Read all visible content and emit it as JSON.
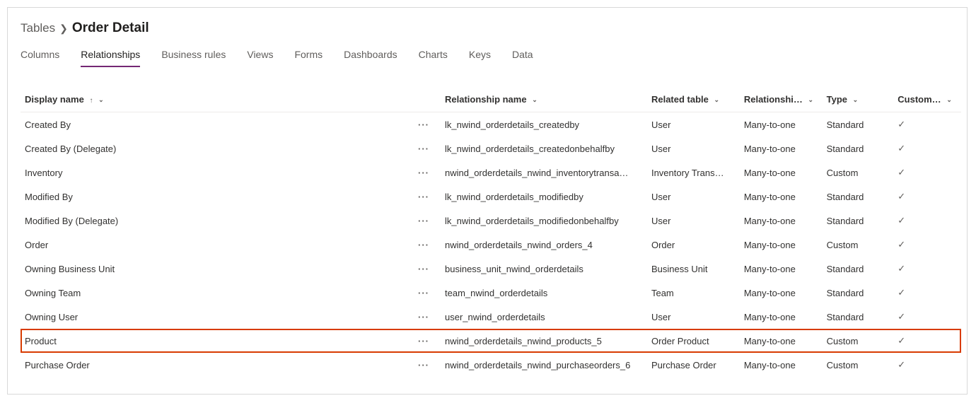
{
  "breadcrumb": {
    "root": "Tables",
    "current": "Order Detail"
  },
  "tabs": [
    {
      "label": "Columns",
      "active": false
    },
    {
      "label": "Relationships",
      "active": true
    },
    {
      "label": "Business rules",
      "active": false
    },
    {
      "label": "Views",
      "active": false
    },
    {
      "label": "Forms",
      "active": false
    },
    {
      "label": "Dashboards",
      "active": false
    },
    {
      "label": "Charts",
      "active": false
    },
    {
      "label": "Keys",
      "active": false
    },
    {
      "label": "Data",
      "active": false
    }
  ],
  "columns": {
    "display_name": "Display name",
    "relationship_name": "Relationship name",
    "related_table": "Related table",
    "relationship_type": "Relationshi…",
    "type": "Type",
    "customizable": "Custom…"
  },
  "rows": [
    {
      "display": "Created By",
      "relname": "lk_nwind_orderdetails_createdby",
      "related": "User",
      "reltype": "Many-to-one",
      "type": "Standard",
      "custom": true,
      "highlight": false
    },
    {
      "display": "Created By (Delegate)",
      "relname": "lk_nwind_orderdetails_createdonbehalfby",
      "related": "User",
      "reltype": "Many-to-one",
      "type": "Standard",
      "custom": true,
      "highlight": false
    },
    {
      "display": "Inventory",
      "relname": "nwind_orderdetails_nwind_inventorytransa…",
      "related": "Inventory Trans…",
      "reltype": "Many-to-one",
      "type": "Custom",
      "custom": true,
      "highlight": false
    },
    {
      "display": "Modified By",
      "relname": "lk_nwind_orderdetails_modifiedby",
      "related": "User",
      "reltype": "Many-to-one",
      "type": "Standard",
      "custom": true,
      "highlight": false
    },
    {
      "display": "Modified By (Delegate)",
      "relname": "lk_nwind_orderdetails_modifiedonbehalfby",
      "related": "User",
      "reltype": "Many-to-one",
      "type": "Standard",
      "custom": true,
      "highlight": false
    },
    {
      "display": "Order",
      "relname": "nwind_orderdetails_nwind_orders_4",
      "related": "Order",
      "reltype": "Many-to-one",
      "type": "Custom",
      "custom": true,
      "highlight": false
    },
    {
      "display": "Owning Business Unit",
      "relname": "business_unit_nwind_orderdetails",
      "related": "Business Unit",
      "reltype": "Many-to-one",
      "type": "Standard",
      "custom": true,
      "highlight": false
    },
    {
      "display": "Owning Team",
      "relname": "team_nwind_orderdetails",
      "related": "Team",
      "reltype": "Many-to-one",
      "type": "Standard",
      "custom": true,
      "highlight": false
    },
    {
      "display": "Owning User",
      "relname": "user_nwind_orderdetails",
      "related": "User",
      "reltype": "Many-to-one",
      "type": "Standard",
      "custom": true,
      "highlight": false
    },
    {
      "display": "Product",
      "relname": "nwind_orderdetails_nwind_products_5",
      "related": "Order Product",
      "reltype": "Many-to-one",
      "type": "Custom",
      "custom": true,
      "highlight": true
    },
    {
      "display": "Purchase Order",
      "relname": "nwind_orderdetails_nwind_purchaseorders_6",
      "related": "Purchase Order",
      "reltype": "Many-to-one",
      "type": "Custom",
      "custom": true,
      "highlight": false
    }
  ]
}
